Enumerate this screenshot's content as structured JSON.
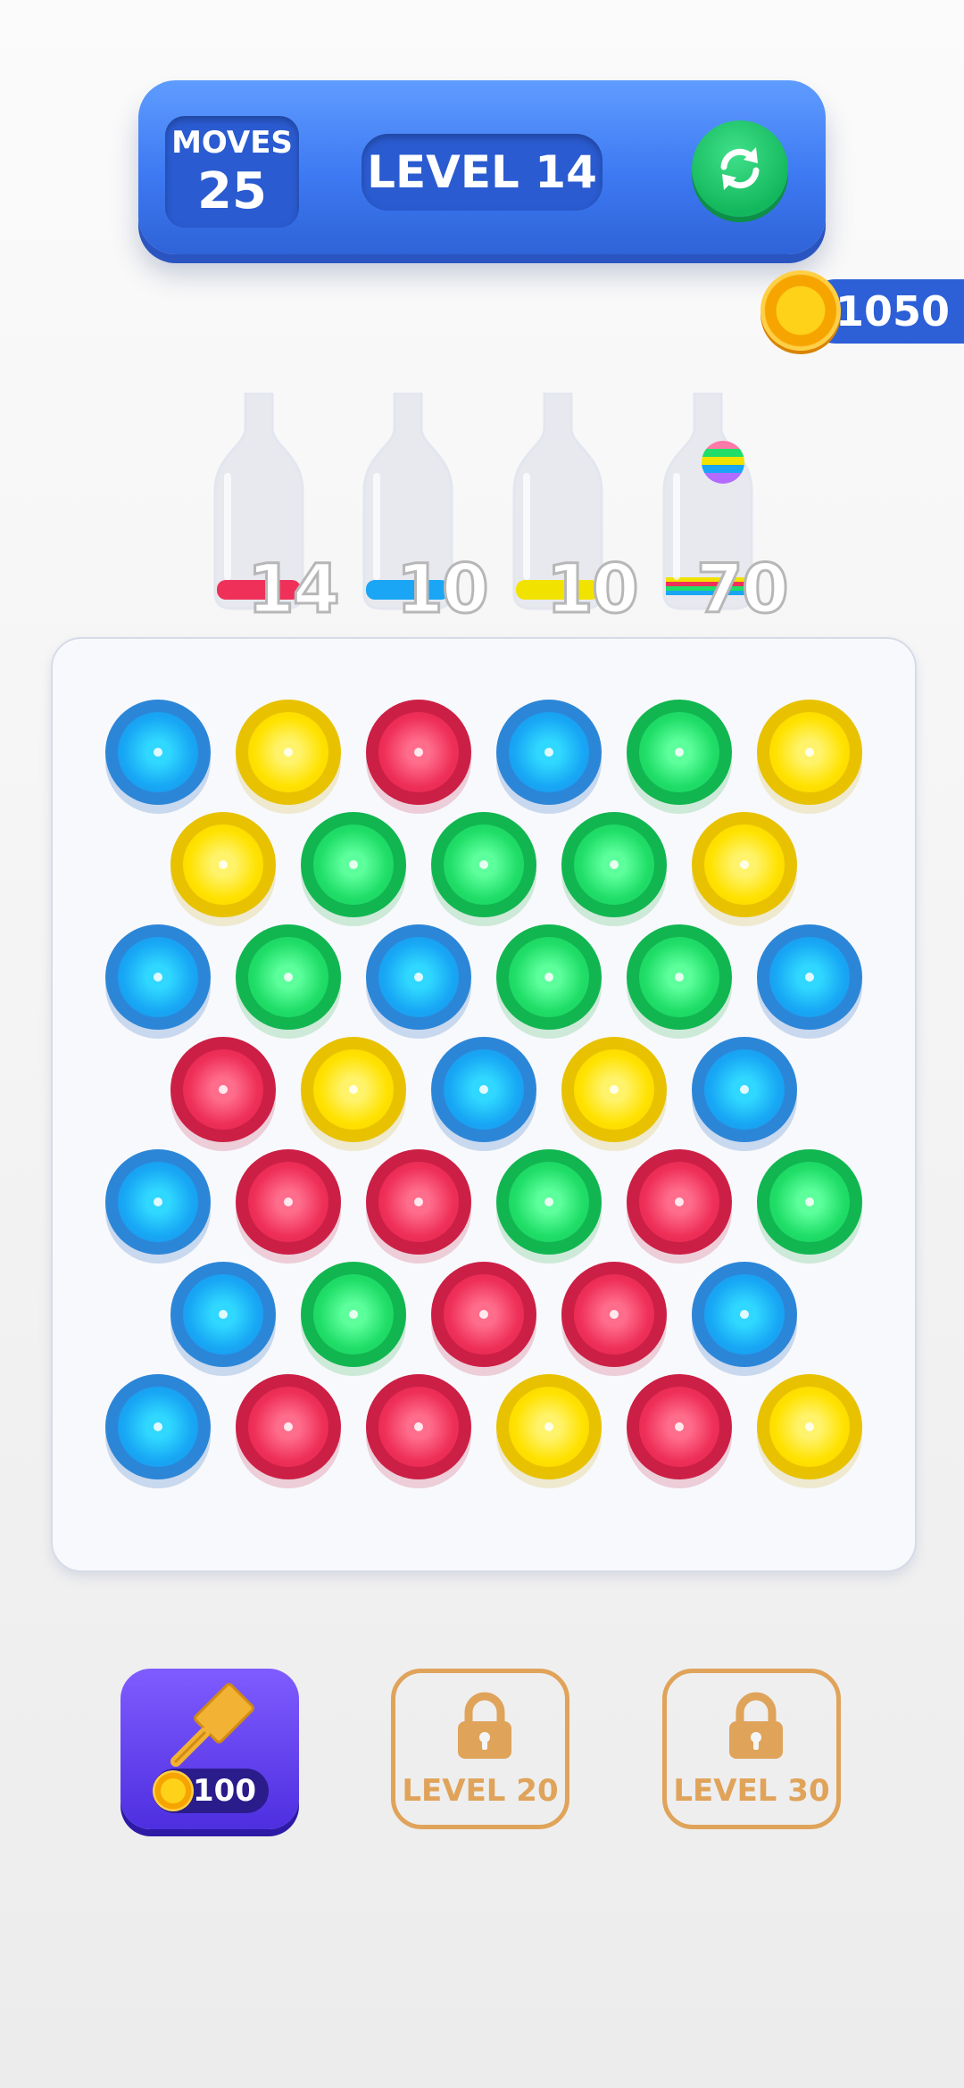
{
  "hud": {
    "moves_label": "MOVES",
    "moves_value": "25",
    "level_label": "LEVEL 14",
    "restart_icon": "restart-icon"
  },
  "coins": {
    "amount": "1050",
    "icon": "coin-icon"
  },
  "bottles": [
    {
      "count": "14",
      "liquid_color": "#ef3159"
    },
    {
      "count": "10",
      "liquid_color": "#1aa5f5"
    },
    {
      "count": "10",
      "liquid_color": "#f2e200"
    },
    {
      "count": "70",
      "liquid_color": "rainbow",
      "has_rainbow_ball": true
    }
  ],
  "board": {
    "rows": [
      [
        "blue",
        "yellow",
        "red",
        "blue",
        "green",
        "yellow"
      ],
      [
        "yellow",
        "green",
        "green",
        "green",
        "yellow"
      ],
      [
        "blue",
        "green",
        "blue",
        "green",
        "green",
        "blue"
      ],
      [
        "red",
        "yellow",
        "blue",
        "yellow",
        "blue"
      ],
      [
        "blue",
        "red",
        "red",
        "green",
        "red",
        "green"
      ],
      [
        "blue",
        "green",
        "red",
        "red",
        "blue"
      ],
      [
        "blue",
        "red",
        "red",
        "yellow",
        "red",
        "yellow"
      ]
    ]
  },
  "powerups": {
    "hammer": {
      "icon": "hammer-icon",
      "price": "100"
    },
    "locked_1": {
      "icon": "lock-icon",
      "label": "LEVEL 20"
    },
    "locked_2": {
      "icon": "lock-icon",
      "label": "LEVEL 30"
    }
  },
  "colors": {
    "panel_blue": "#3d79f2",
    "restart_green": "#14b85c",
    "hammer_purple": "#5a3af0",
    "locked_orange": "#e0a35a"
  }
}
